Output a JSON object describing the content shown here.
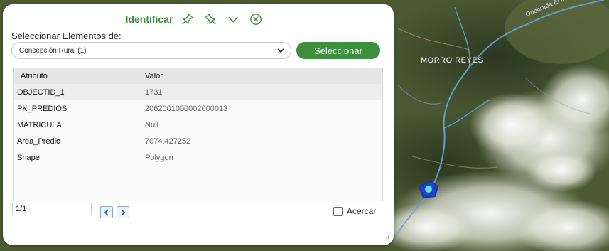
{
  "panel": {
    "title": "Identificar",
    "select_label": "Seleccionar Elementos de:",
    "dropdown_value": "Concepción Rural (1)",
    "select_button": "Seleccionar"
  },
  "table": {
    "headers": [
      "Atributo",
      "Valor"
    ],
    "rows": [
      {
        "attr": "OBJECTID_1",
        "value": "1731"
      },
      {
        "attr": "PK_PREDIOS",
        "value": "2062001000002000013"
      },
      {
        "attr": "MATRICULA",
        "value": "Null"
      },
      {
        "attr": "Area_Predio",
        "value": "7074.427252"
      },
      {
        "attr": "Shape",
        "value": "Polygon"
      }
    ]
  },
  "pager": {
    "value": "1/1"
  },
  "zoom_checkbox": {
    "label": "Acercar"
  },
  "map": {
    "place_label": "MORRO REYES",
    "stream_label": "Quebrada El Mor"
  },
  "colors": {
    "accent": "#3d8f3d",
    "highlight": "#1f3fd1"
  },
  "icons": [
    "pin-icon",
    "unpin-icon",
    "chevron-down-icon",
    "close-icon",
    "chevron-left-icon",
    "chevron-right-icon"
  ]
}
